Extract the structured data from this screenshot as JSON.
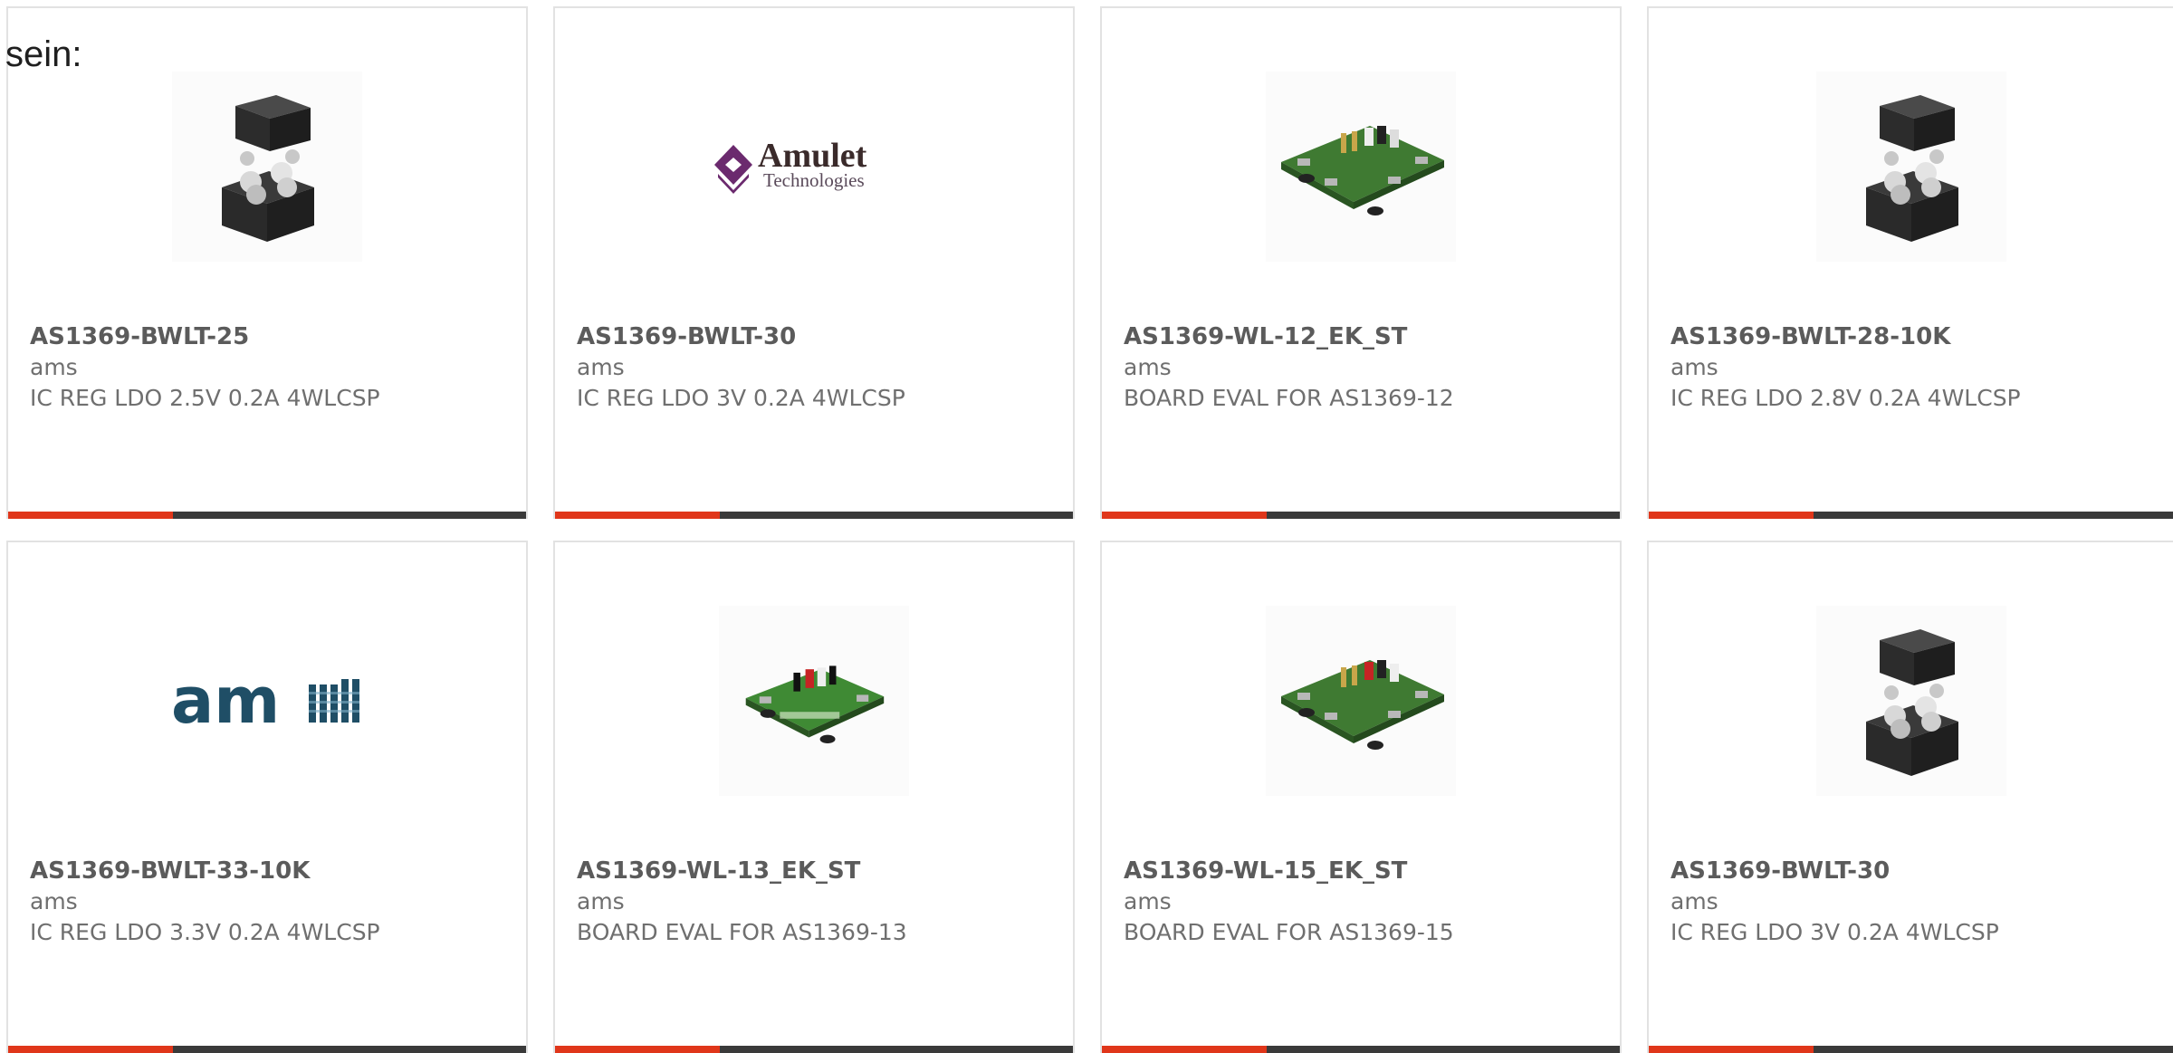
{
  "intro_text": "sein:",
  "colors": {
    "accent": "#e0361a",
    "bar_dark": "#3a3a3a",
    "card_border": "#e2e2e2",
    "text_title": "#5b5b5b",
    "text_body": "#6f6f6f"
  },
  "products": [
    {
      "part": "AS1369-BWLT-25",
      "manufacturer": "ams",
      "description": "IC REG LDO 2.5V 0.2A 4WLCSP",
      "image": "wlcsp-chip-icon"
    },
    {
      "part": "AS1369-BWLT-30",
      "manufacturer": "ams",
      "description": "IC REG LDO 3V 0.2A 4WLCSP",
      "image": "amulet-logo",
      "logo_name": "Amulet",
      "logo_sub": "Technologies"
    },
    {
      "part": "AS1369-WL-12_EK_ST",
      "manufacturer": "ams",
      "description": "BOARD EVAL FOR AS1369-12",
      "image": "eval-board-icon"
    },
    {
      "part": "AS1369-BWLT-28-10K",
      "manufacturer": "ams",
      "description": "IC REG LDO 2.8V 0.2A 4WLCSP",
      "image": "wlcsp-chip-icon"
    },
    {
      "part": "AS1369-BWLT-33-10K",
      "manufacturer": "ams",
      "description": "IC REG LDO 3.3V 0.2A 4WLCSP",
      "image": "ams-logo",
      "logo_name": "am"
    },
    {
      "part": "AS1369-WL-13_EK_ST",
      "manufacturer": "ams",
      "description": "BOARD EVAL FOR AS1369-13",
      "image": "eval-board-icon"
    },
    {
      "part": "AS1369-WL-15_EK_ST",
      "manufacturer": "ams",
      "description": "BOARD EVAL FOR AS1369-15",
      "image": "eval-board-icon"
    },
    {
      "part": "AS1369-BWLT-30",
      "manufacturer": "ams",
      "description": "IC REG LDO 3V 0.2A 4WLCSP",
      "image": "wlcsp-chip-icon"
    }
  ]
}
